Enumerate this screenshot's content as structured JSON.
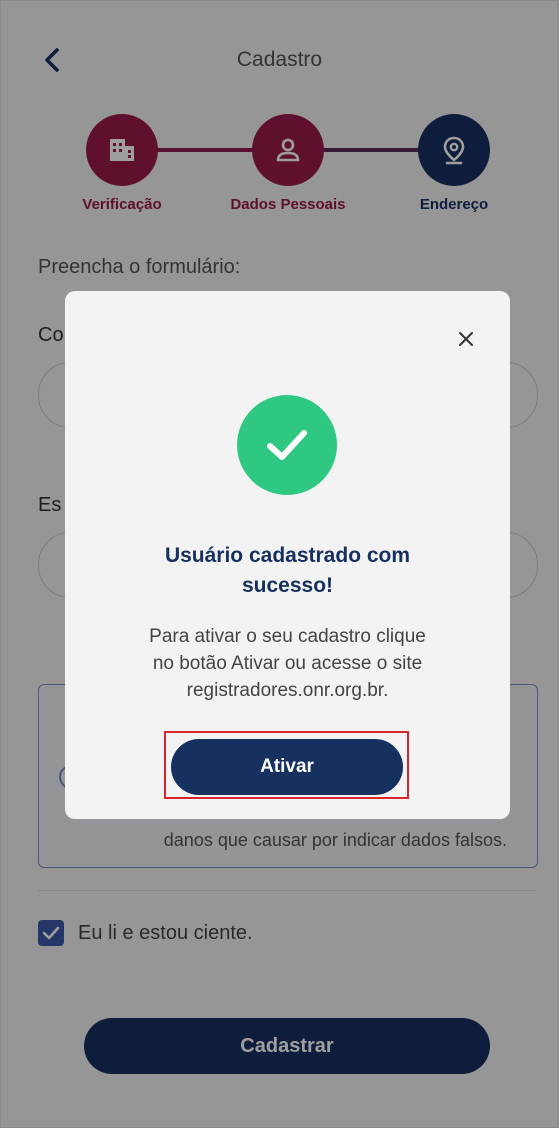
{
  "header": {
    "title": "Cadastro"
  },
  "stepper": {
    "steps": [
      {
        "label": "Verificação",
        "icon": "building-icon",
        "state": "done"
      },
      {
        "label": "Dados Pessoais",
        "icon": "person-icon",
        "state": "done"
      },
      {
        "label": "Endereço",
        "icon": "location-pin-icon",
        "state": "current"
      }
    ]
  },
  "form": {
    "hint": "Preencha o formulário:",
    "field1_label": "Co",
    "field2_label": "Es"
  },
  "notice": {
    "text_visible": "danos que causar por indicar dados falsos."
  },
  "agreement": {
    "label": "Eu li e estou ciente.",
    "checked": true
  },
  "submit": {
    "label": "Cadastrar"
  },
  "modal": {
    "title_line1": "Usuário cadastrado com",
    "title_line2": "sucesso!",
    "message_line1": "Para ativar o seu cadastro clique",
    "message_line2": "no botão Ativar ou acesse o site",
    "message_line3": "registradores.onr.org.br.",
    "button_label": "Ativar",
    "icon": "check-circle-icon"
  },
  "colors": {
    "primary_navy": "#16305f",
    "step_done": "#9b1a4d",
    "success_green": "#2ec882",
    "highlight_red": "#d8262c"
  }
}
